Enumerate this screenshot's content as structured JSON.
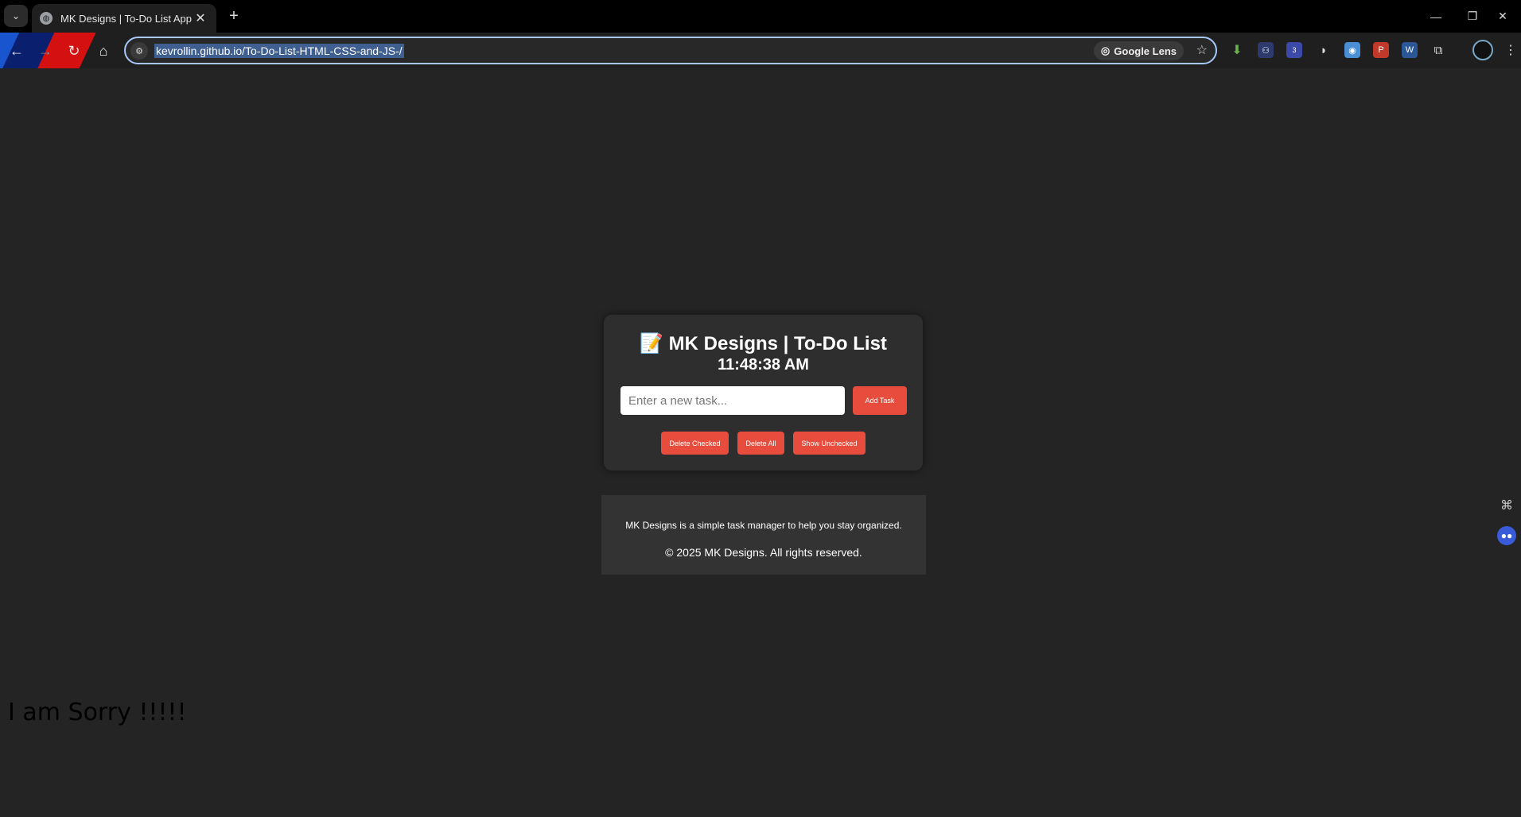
{
  "browser": {
    "tab_title": "MK Designs | To-Do List App",
    "url": "kevrollin.github.io/To-Do-List-HTML-CSS-and-JS-/",
    "lens_label": "Google Lens",
    "ext_badge": "3"
  },
  "app": {
    "emoji": "📝",
    "title": "MK Designs | To-Do List",
    "clock": "11:48:38 AM",
    "input_placeholder": "Enter a new task...",
    "add_button": "Add Task",
    "delete_checked": "Delete Checked",
    "delete_all": "Delete All",
    "show_unchecked": "Show Unchecked"
  },
  "footer": {
    "description": "MK Designs is a simple task manager to help you stay organized.",
    "copyright": "© 2025 MK Designs. All rights reserved."
  },
  "overlay_text": "I am Sorry !!!!!",
  "colors": {
    "accent": "#e74c3c",
    "page_bg": "#242424",
    "card_bg": "#2e2e2e"
  }
}
